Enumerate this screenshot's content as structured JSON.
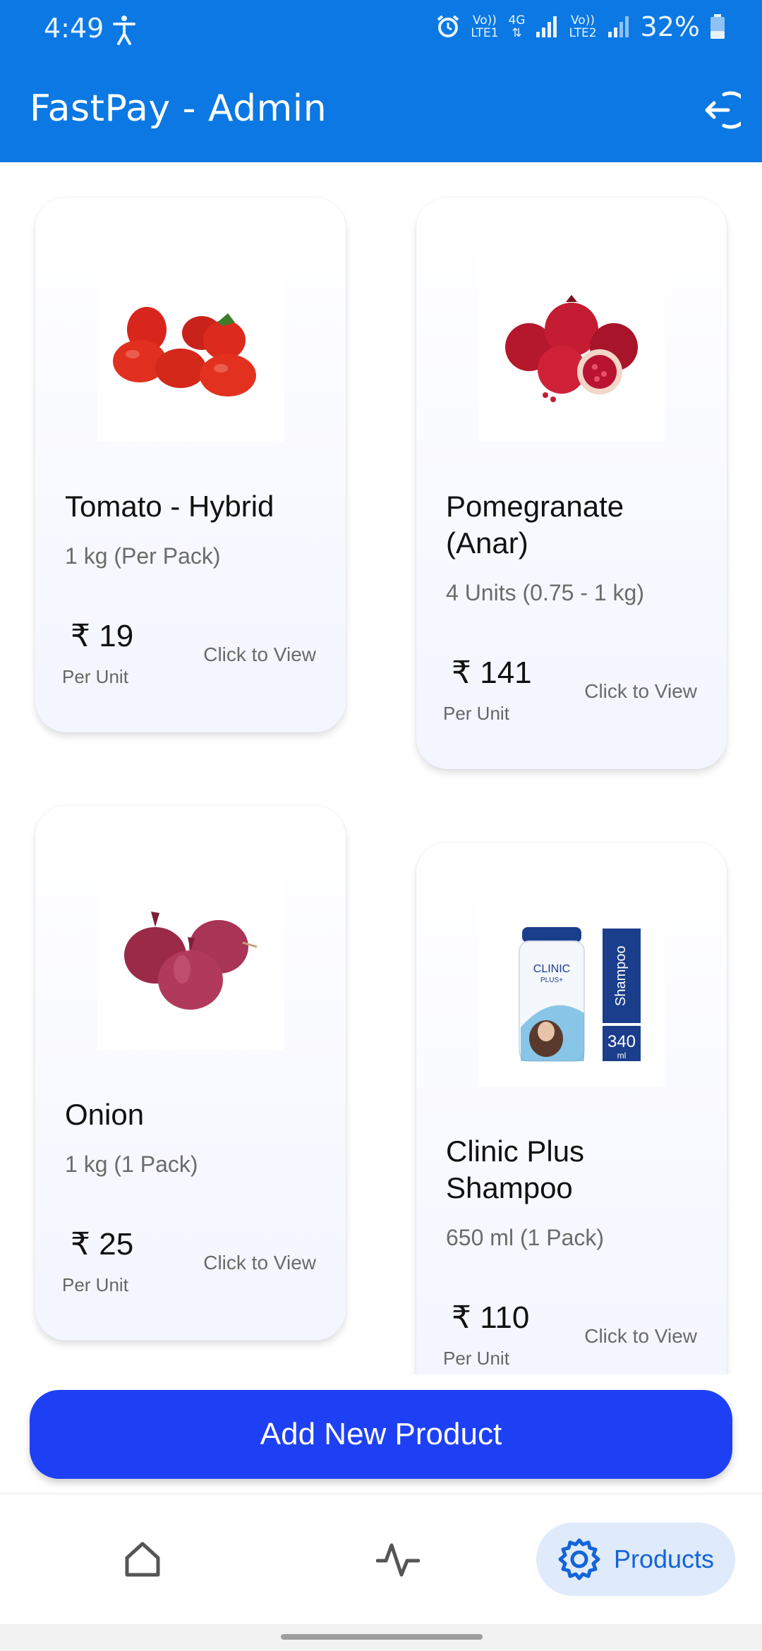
{
  "status_bar": {
    "time": "4:49",
    "sim1_line1": "Vo))",
    "sim1_line2": "LTE1",
    "net_type": "4G",
    "sim2_line1": "Vo))",
    "sim2_line2": "LTE2",
    "battery": "32%"
  },
  "app_bar": {
    "title": "FastPay - Admin",
    "logout_icon": "logout-icon"
  },
  "products": [
    {
      "name": "Tomato - Hybrid",
      "quantity": "1 kg (Per Pack)",
      "price": "₹ 19",
      "per_unit": "Per Unit",
      "action": "Click to View",
      "image_icon": "tomato-image"
    },
    {
      "name": "Pomegranate (Anar)",
      "quantity": "4 Units (0.75 - 1 kg)",
      "price": "₹ 141",
      "per_unit": "Per Unit",
      "action": "Click to View",
      "image_icon": "pomegranate-image"
    },
    {
      "name": "Onion",
      "quantity": "1 kg (1 Pack)",
      "price": "₹ 25",
      "per_unit": "Per Unit",
      "action": "Click to View",
      "image_icon": "onion-image"
    },
    {
      "name": "Clinic Plus Shampoo",
      "quantity": "650 ml (1 Pack)",
      "price": "₹ 110",
      "per_unit": "Per Unit",
      "action": "Click to View",
      "image_icon": "shampoo-image",
      "packshot": {
        "brand": "CLINIC",
        "brand_sub": "PLUS+",
        "side_label": "Shampoo",
        "volume": "340",
        "volume_unit": "ml"
      }
    }
  ],
  "add_button": {
    "label": "Add New Product"
  },
  "bottom_nav": {
    "items": [
      {
        "icon": "home-icon",
        "label": ""
      },
      {
        "icon": "activity-icon",
        "label": ""
      },
      {
        "icon": "gear-icon",
        "label": "Products",
        "active": true
      }
    ]
  },
  "colors": {
    "app_bar": "#0b78e3",
    "add_button": "#1e40f5",
    "active_nav_bg": "#dfeafb",
    "active_nav_text": "#1464d8"
  }
}
